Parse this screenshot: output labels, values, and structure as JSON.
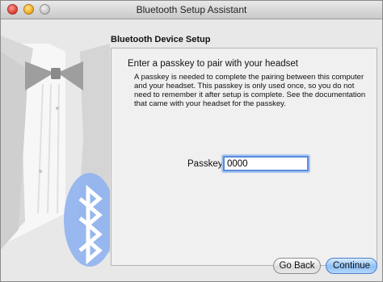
{
  "window": {
    "title": "Bluetooth Setup Assistant"
  },
  "section": {
    "title": "Bluetooth Device Setup"
  },
  "panel": {
    "heading": "Enter a passkey to pair with your headset",
    "description": "A passkey is needed to complete the pairing between this computer and your headset. This passkey is only used once, so you do not need to remember it after setup is complete. See the documentation that came with your headset for the passkey.",
    "passkey_label": "Passkey:",
    "passkey_value": "0000"
  },
  "buttons": {
    "back": "Go Back",
    "continue": "Continue"
  },
  "colors": {
    "accent": "#5a8bdc",
    "default_button": "#8ec0f5"
  }
}
